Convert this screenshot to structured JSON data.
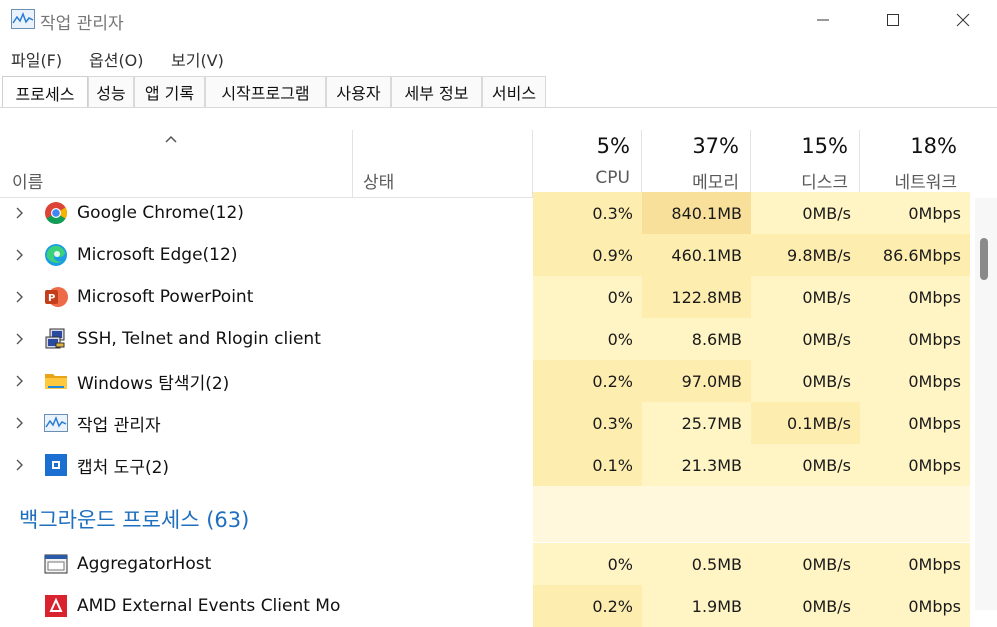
{
  "window": {
    "title": "작업 관리자"
  },
  "menu": [
    {
      "label": "파일(F)"
    },
    {
      "label": "옵션(O)"
    },
    {
      "label": "보기(V)"
    }
  ],
  "tabs": [
    {
      "label": "프로세스"
    },
    {
      "label": "성능"
    },
    {
      "label": "앱 기록"
    },
    {
      "label": "시작프로그램"
    },
    {
      "label": "사용자"
    },
    {
      "label": "세부 정보"
    },
    {
      "label": "서비스"
    }
  ],
  "header": {
    "name": "이름",
    "status": "상태",
    "cpu": {
      "pct": "5%",
      "label": "CPU"
    },
    "mem": {
      "pct": "37%",
      "label": "메모리"
    },
    "disk": {
      "pct": "15%",
      "label": "디스크"
    },
    "net": {
      "pct": "18%",
      "label": "네트워크"
    }
  },
  "apps": [
    {
      "name": "Google Chrome(12)",
      "icon": "chrome-icon",
      "cpu": "0.3%",
      "mem": "840.1MB",
      "disk": "0MB/s",
      "net": "0Mbps"
    },
    {
      "name": "Microsoft Edge(12)",
      "icon": "edge-icon",
      "cpu": "0.9%",
      "mem": "460.1MB",
      "disk": "9.8MB/s",
      "net": "86.6Mbps"
    },
    {
      "name": "Microsoft PowerPoint",
      "icon": "powerpoint-icon",
      "cpu": "0%",
      "mem": "122.8MB",
      "disk": "0MB/s",
      "net": "0Mbps"
    },
    {
      "name": "SSH, Telnet and Rlogin client",
      "icon": "ssh-client-icon",
      "cpu": "0%",
      "mem": "8.6MB",
      "disk": "0MB/s",
      "net": "0Mbps"
    },
    {
      "name": "Windows 탐색기(2)",
      "icon": "folder-icon",
      "cpu": "0.2%",
      "mem": "97.0MB",
      "disk": "0MB/s",
      "net": "0Mbps"
    },
    {
      "name": "작업 관리자",
      "icon": "task-manager-icon",
      "cpu": "0.3%",
      "mem": "25.7MB",
      "disk": "0.1MB/s",
      "net": "0Mbps"
    },
    {
      "name": "캡처 도구(2)",
      "icon": "snipping-tool-icon",
      "cpu": "0.1%",
      "mem": "21.3MB",
      "disk": "0MB/s",
      "net": "0Mbps"
    }
  ],
  "background_section": {
    "title": "백그라운드 프로세스 (63)"
  },
  "background": [
    {
      "name": "AggregatorHost",
      "icon": "app-window-icon",
      "cpu": "0%",
      "mem": "0.5MB",
      "disk": "0MB/s",
      "net": "0Mbps"
    },
    {
      "name": "AMD External Events Client Mo",
      "icon": "amd-icon",
      "cpu": "0.2%",
      "mem": "1.9MB",
      "disk": "0MB/s",
      "net": "0Mbps"
    }
  ],
  "colors": {
    "heat_light": "#fff4c4",
    "heat_mid": "#fdeeb0",
    "heat_strong": "#f9e09a",
    "section_blue": "#1f6fbf"
  }
}
